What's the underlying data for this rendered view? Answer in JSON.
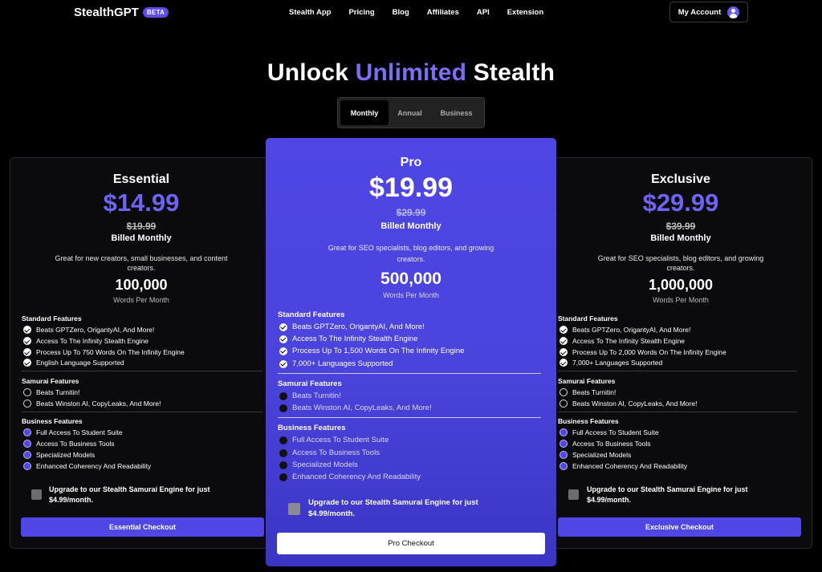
{
  "nav": {
    "logo": "StealthGPT",
    "badge": "BETA",
    "links": [
      "Stealth App",
      "Pricing",
      "Blog",
      "Affiliates",
      "API",
      "Extension"
    ],
    "account": "My Account"
  },
  "headline": {
    "part1": "Unlock",
    "accent": "Unlimited",
    "part2": "Stealth"
  },
  "billing_tabs": [
    "Monthly",
    "Annual",
    "Business"
  ],
  "active_tab": "Monthly",
  "section_titles": {
    "standard": "Standard Features",
    "samurai": "Samurai Features",
    "business": "Business Features"
  },
  "upgrade_text_1": "Upgrade to our Stealth Samurai Engine for just",
  "upgrade_text_2": "$4.99/month.",
  "plans": [
    {
      "name": "Essential",
      "price": "$14.99",
      "old_price": "$19.99",
      "billed": "Billed Monthly",
      "desc_1": "Great for new creators, small businesses, and content",
      "desc_2": "creators.",
      "words": "100,000",
      "words_label": "Words Per Month",
      "standard": [
        "Beats GPTZero, OrigantyAI, And More!",
        "Access To The Infinity Stealth Engine",
        "Process Up To 750 Words On The Infinity Engine",
        "English Language Supported"
      ],
      "samurai": [
        "Beats Turnitin!",
        "Beats Winston AI, CopyLeaks, And More!"
      ],
      "business": [
        "Full Access To Student Suite",
        "Access To Business Tools",
        "Specialized Models",
        "Enhanced Coherency And Readability"
      ],
      "checkout": "Essential Checkout"
    },
    {
      "name": "Pro",
      "price": "$19.99",
      "old_price": "$29.99",
      "billed": "Billed Monthly",
      "desc_1": "Great for SEO specialists, blog editors, and growing",
      "desc_2": "creators.",
      "words": "500,000",
      "words_label": "Words Per Month",
      "standard": [
        "Beats GPTZero, OrigantyAI, And More!",
        "Access To The Infinity Stealth Engine",
        "Process Up To 1,500 Words On The Infinity Engine",
        "7,000+ Languages Supported"
      ],
      "samurai": [
        "Beats Turnitin!",
        "Beats Winston AI, CopyLeaks, And More!"
      ],
      "business": [
        "Full Access To Student Suite",
        "Access To Business Tools",
        "Specialized Models",
        "Enhanced Coherency And Readability"
      ],
      "checkout": "Pro Checkout"
    },
    {
      "name": "Exclusive",
      "price": "$29.99",
      "old_price": "$39.99",
      "billed": "Billed Monthly",
      "desc_1": "Great for SEO specialists, blog editors, and growing",
      "desc_2": "creators.",
      "words": "1,000,000",
      "words_label": "Words Per Month",
      "standard": [
        "Beats GPTZero, OrigantyAI, And More!",
        "Access To The Infinity Stealth Engine",
        "Process Up To 2,000 Words On The Infinity Engine",
        "7,000+ Languages Supported"
      ],
      "samurai": [
        "Beats Turnitin!",
        "Beats Winston AI, CopyLeaks, And More!"
      ],
      "business": [
        "Full Access To Student Suite",
        "Access To Business Tools",
        "Specialized Models",
        "Enhanced Coherency And Readability"
      ],
      "checkout": "Exclusive Checkout"
    }
  ]
}
